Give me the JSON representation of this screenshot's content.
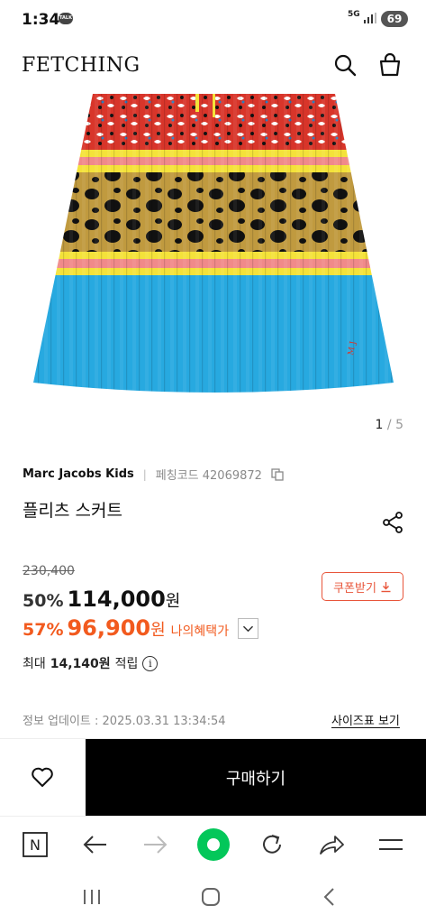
{
  "status": {
    "time": "1:34",
    "talk": "TALK",
    "network": "5G",
    "battery": "69"
  },
  "header": {
    "logo": "FETCHING",
    "search_icon": "search-icon",
    "bag_icon": "shopping-bag-icon"
  },
  "gallery": {
    "current": "1",
    "total": "/ 5"
  },
  "product": {
    "brand": "Marc Jacobs Kids",
    "code_label": "페칭코드 42069872",
    "title": "플리츠 스커트",
    "original_price": "230,400",
    "discount1": "50%",
    "price1": "114,000",
    "won": "원",
    "discount2": "57%",
    "price2": "96,900",
    "benefit_label": "나의혜택가",
    "coupon_label": "쿠폰받기",
    "points_prefix": "최대",
    "points_amount": "14,140원",
    "points_suffix": "적립",
    "info_glyph": "i",
    "updated": "정보 업데이트 : 2025.03.31 13:34:54",
    "size_chart": "사이즈표 보기"
  },
  "buy_bar": {
    "buy_label": "구매하기"
  },
  "browser": {
    "home_glyph": "N"
  },
  "colors": {
    "accent": "#f25a1e",
    "coupon": "#e8553a",
    "naver_green": "#03c75a",
    "skirt_blue": "#27a9e0"
  }
}
